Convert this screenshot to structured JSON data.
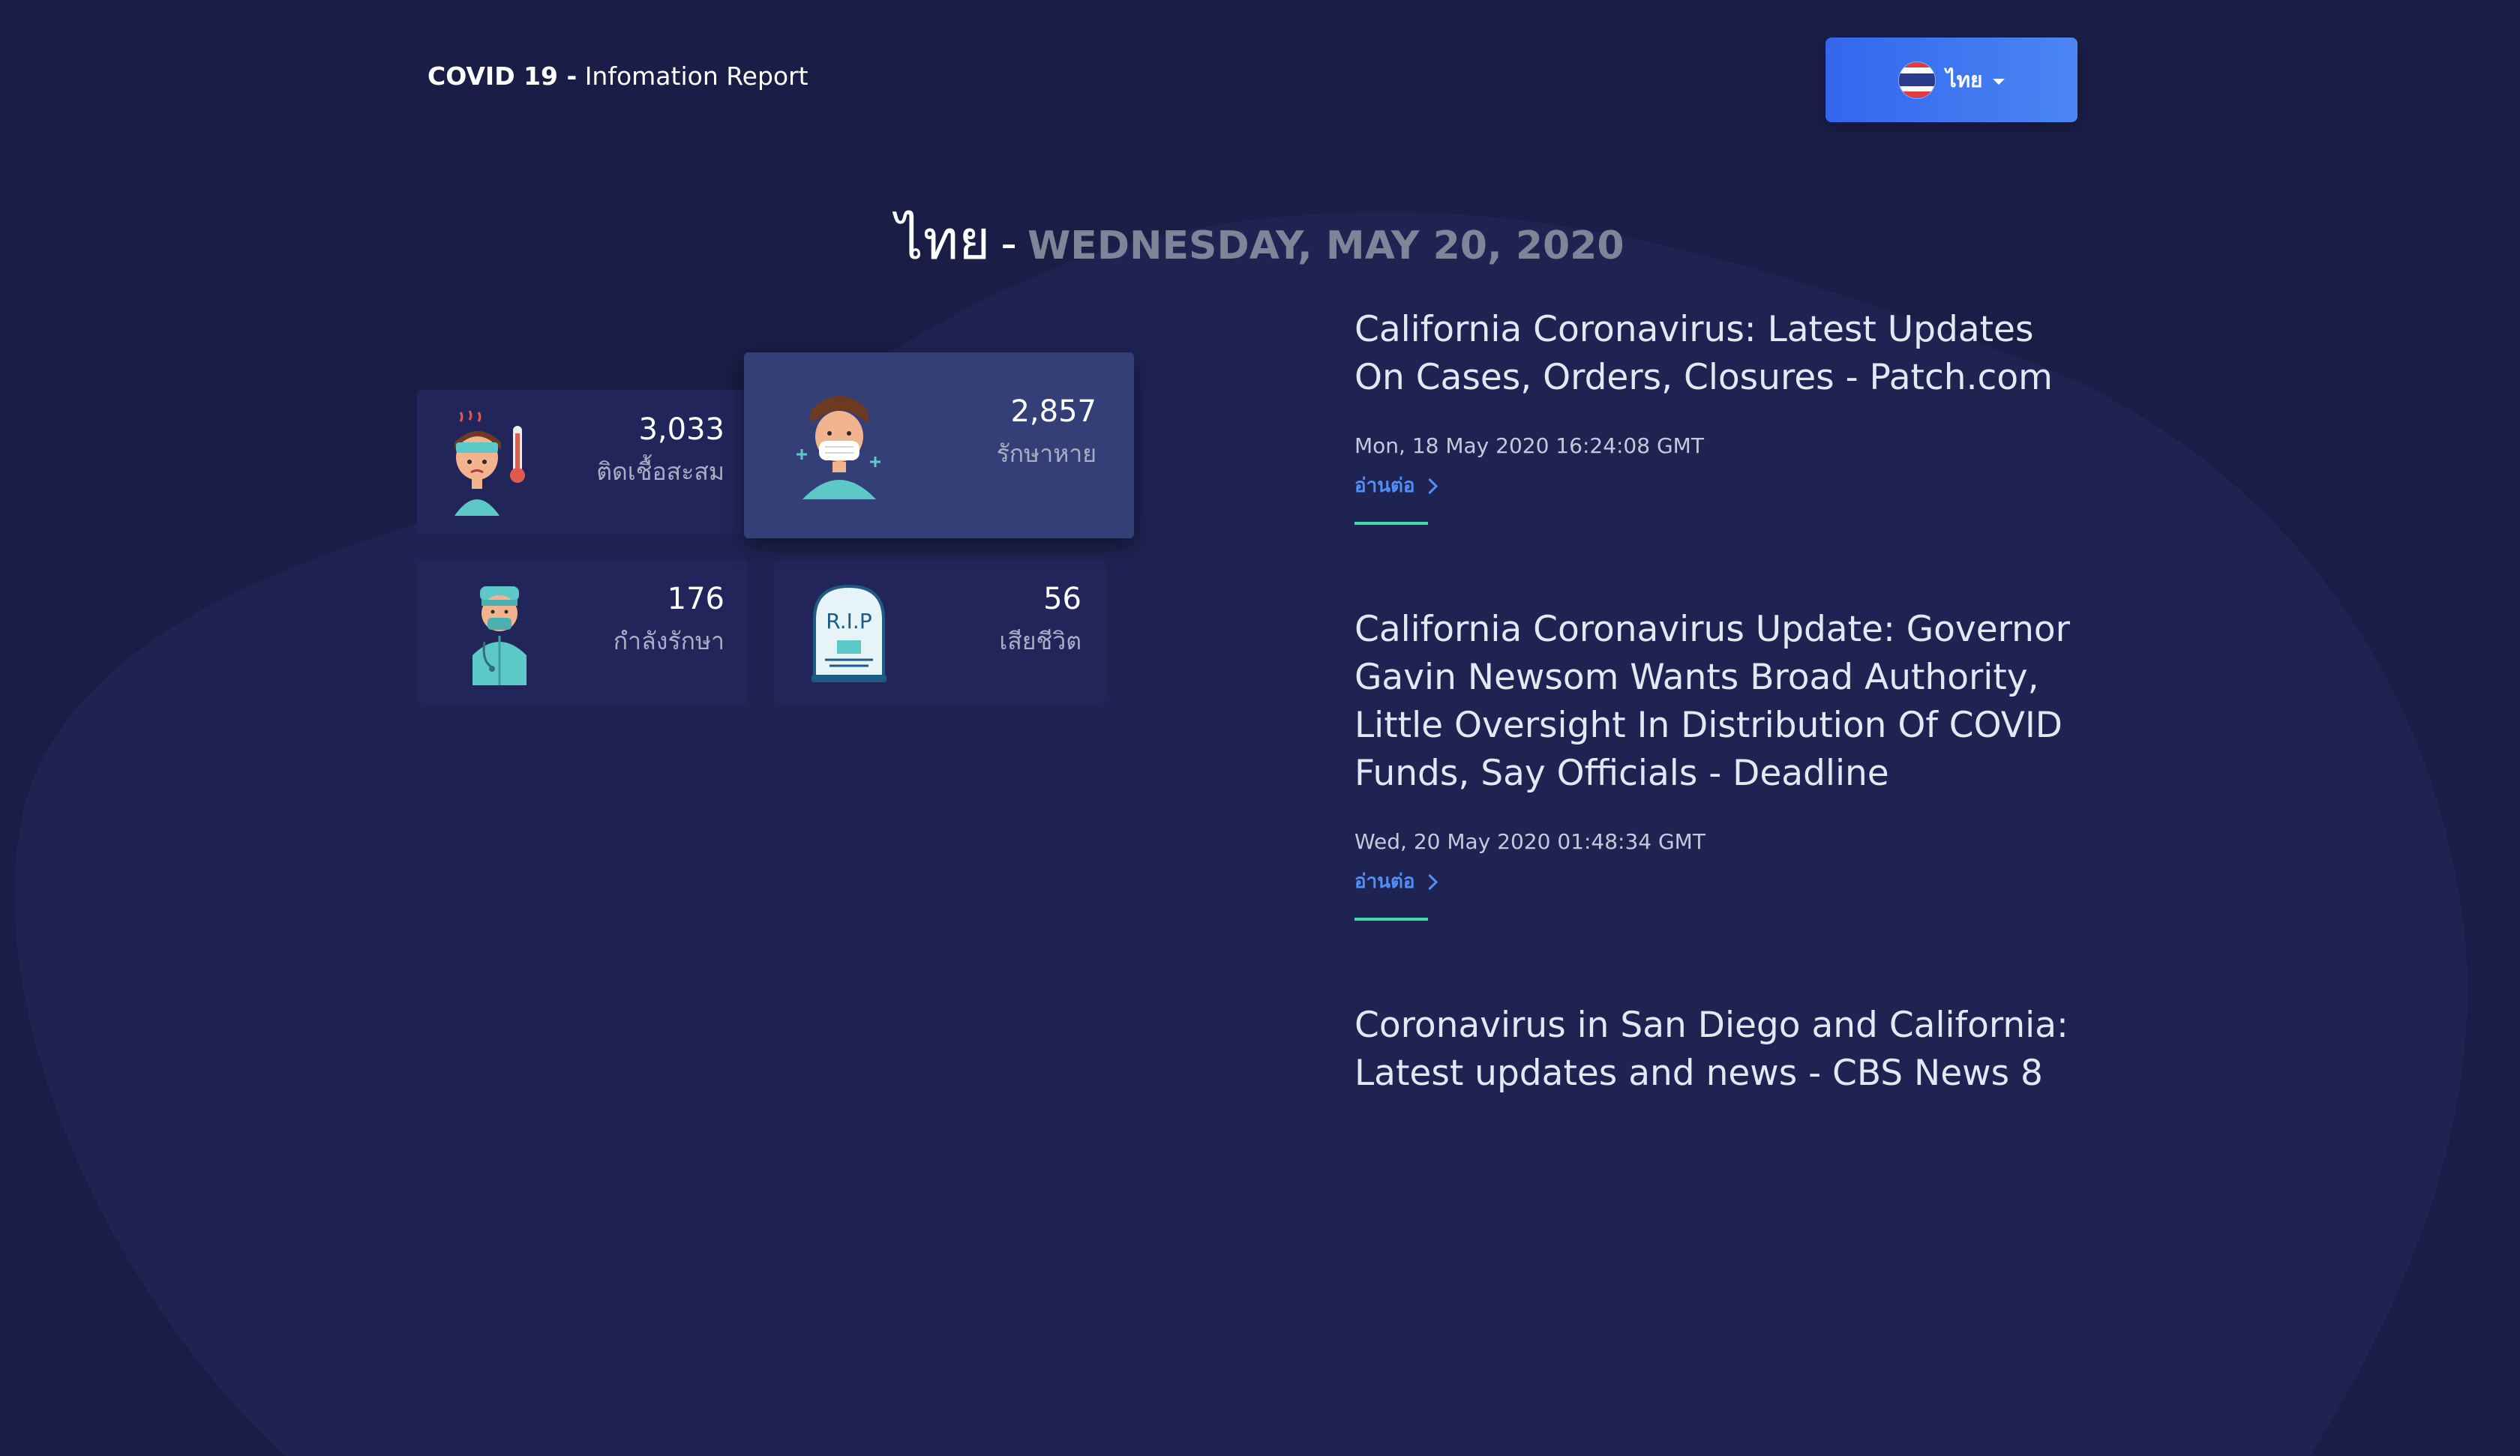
{
  "header": {
    "brand_bold": "COVID 19 -",
    "brand_rest": " Infomation Report",
    "language": {
      "label": "ไทย"
    }
  },
  "heading": {
    "country": "ไทย",
    "separator": "-",
    "date": "WEDNESDAY, MAY 20, 2020"
  },
  "stats": {
    "infected": {
      "value": "3,033",
      "label": "ติดเชื้อสะสม",
      "icon": "sick-person-thermometer-icon"
    },
    "recovered": {
      "value": "2,857",
      "label": "รักษาหาย",
      "icon": "masked-person-icon"
    },
    "treating": {
      "value": "176",
      "label": "กำลังรักษา",
      "icon": "doctor-icon"
    },
    "deaths": {
      "value": "56",
      "label": "เสียชีวิต",
      "icon": "rip-tombstone-icon"
    }
  },
  "news": [
    {
      "title": "California Coronavirus: Latest Updates On Cases, Orders, Closures - Patch.com",
      "date": "Mon, 18 May 2020 16:24:08 GMT",
      "more": "อ่านต่อ"
    },
    {
      "title": "California Coronavirus Update: Governor Gavin Newsom Wants Broad Authority, Little Oversight In Distribution Of COVID Funds, Say Officials - Deadline",
      "date": "Wed, 20 May 2020 01:48:34 GMT",
      "more": "อ่านต่อ"
    },
    {
      "title": "Coronavirus in San Diego and California: Latest updates and news - CBS News 8"
    }
  ],
  "colors": {
    "background": "#1a1d45",
    "card": "#22255a",
    "card_active": "#353f77",
    "accent_blue": "#3a78f0",
    "link_blue": "#4f8ff7",
    "accent_teal": "#3fd9b0",
    "muted_text": "#7f8498"
  }
}
